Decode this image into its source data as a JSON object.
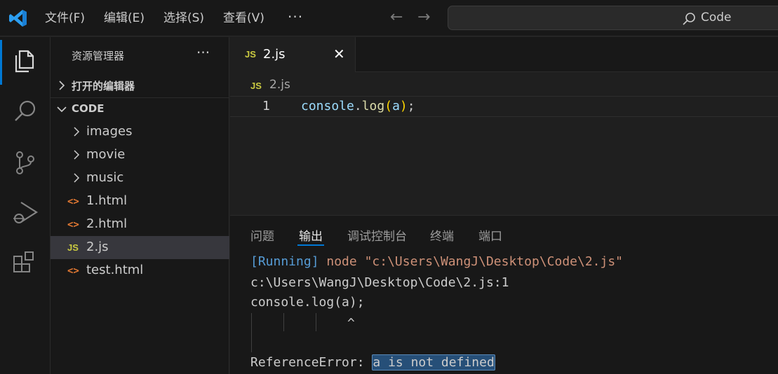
{
  "titlebar": {
    "menus": [
      "文件(F)",
      "编辑(E)",
      "选择(S)",
      "查看(V)"
    ],
    "more": "···",
    "search_label": "Code"
  },
  "activity_bar": {
    "icons": [
      "files-icon",
      "search-icon",
      "source-control-icon",
      "run-debug-icon",
      "extensions-icon"
    ],
    "active": "files-icon",
    "accent_color": "#0078d4"
  },
  "sidebar": {
    "title": "资源管理器",
    "more": "···",
    "sections": {
      "open_editors": "打开的编辑器",
      "workspace": "CODE"
    },
    "tree": [
      {
        "name": "images",
        "kind": "folder"
      },
      {
        "name": "movie",
        "kind": "folder"
      },
      {
        "name": "music",
        "kind": "folder"
      },
      {
        "name": "1.html",
        "kind": "html",
        "icon": "<>"
      },
      {
        "name": "2.html",
        "kind": "html",
        "icon": "<>"
      },
      {
        "name": "2.js",
        "kind": "js",
        "icon": "JS",
        "selected": true
      },
      {
        "name": "test.html",
        "kind": "html",
        "icon": "<>"
      }
    ]
  },
  "editor": {
    "tab": {
      "icon": "JS",
      "label": "2.js",
      "close": "✕"
    },
    "breadcrumb": {
      "icon": "JS",
      "label": "2.js"
    },
    "line_number": "1",
    "code_tokens": {
      "obj": "console",
      "dot": ".",
      "fn": "log",
      "open": "(",
      "arg": "a",
      "close": ")",
      "semi": ";"
    }
  },
  "panel": {
    "tabs": [
      "问题",
      "输出",
      "调试控制台",
      "终端",
      "端口"
    ],
    "active_tab": "输出",
    "output": {
      "running_tag": "[Running]",
      "running_cmd": " node \"c:\\Users\\WangJ\\Desktop\\Code\\2.js\"",
      "line2": "c:\\Users\\WangJ\\Desktop\\Code\\2.js:1",
      "line3": "console.log(a);",
      "caret": "^",
      "error_prefix": "ReferenceError: ",
      "error_selected": "a is not defined"
    }
  }
}
